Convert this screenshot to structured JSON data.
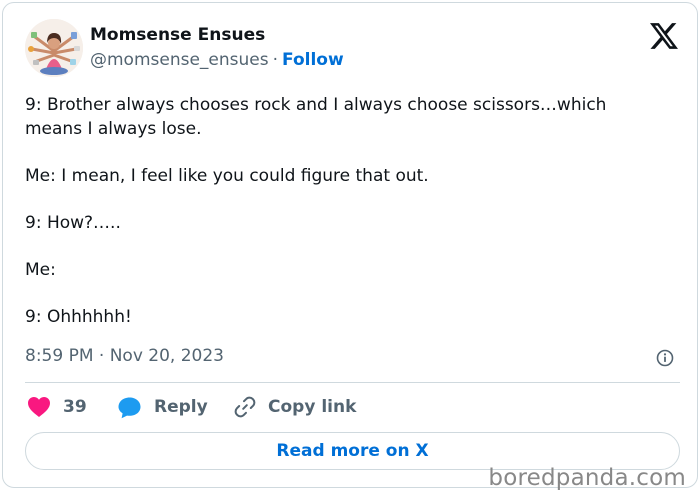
{
  "author": {
    "display_name": "Momsense Ensues",
    "handle": "@momsense_ensues",
    "separator": "·",
    "follow_label": "Follow"
  },
  "tweet": {
    "paragraphs": [
      "9: Brother always chooses rock and I always choose scissors…which means I always lose.",
      "Me: I mean, I feel like you could figure that out.",
      "9: How?…..",
      "Me:",
      "9: Ohhhhhh!"
    ],
    "timestamp": "8:59 PM · Nov 20, 2023"
  },
  "actions": {
    "like_count": "39",
    "reply_label": "Reply",
    "copy_label": "Copy link"
  },
  "read_more_label": "Read more on X",
  "watermark": "boredpanda.com",
  "colors": {
    "like": "#f91880",
    "reply": "#1d9bf0",
    "link": "#006fd6",
    "secondary_text": "#536471",
    "border": "#cfd9de"
  },
  "icons": {
    "platform": "x-logo-icon",
    "info": "info-icon",
    "like": "heart-icon",
    "reply": "speech-bubble-icon",
    "copy": "link-icon"
  }
}
